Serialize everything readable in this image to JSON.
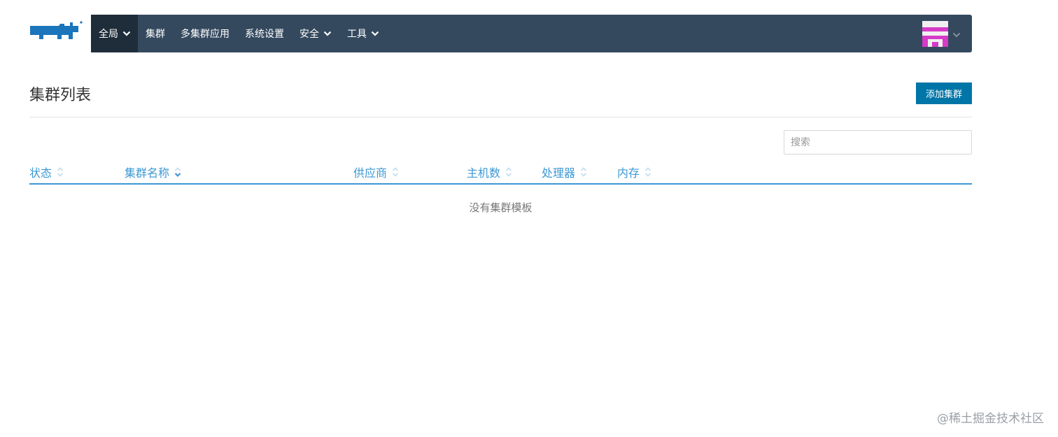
{
  "header": {
    "logo_icon": "rancher-cow-icon",
    "nav": [
      {
        "label": "全局",
        "dropdown": true,
        "active": true
      },
      {
        "label": "集群",
        "dropdown": false,
        "active": false
      },
      {
        "label": "多集群应用",
        "dropdown": false,
        "active": false
      },
      {
        "label": "系统设置",
        "dropdown": false,
        "active": false
      },
      {
        "label": "安全",
        "dropdown": true,
        "active": false
      },
      {
        "label": "工具",
        "dropdown": true,
        "active": false
      }
    ],
    "user_avatar_icon": "identicon-avatar-icon"
  },
  "page": {
    "title": "集群列表",
    "add_button": "添加集群",
    "search_placeholder": "搜索",
    "columns": [
      "状态",
      "集群名称",
      "供应商",
      "主机数",
      "处理器",
      "内存"
    ],
    "sorted_column": "集群名称",
    "empty_message": "没有集群模板"
  },
  "watermark": "@稀土掘金技术社区",
  "colors": {
    "navbar": "#34495e",
    "nav_active": "#1f2d3a",
    "primary": "#0075a8",
    "link": "#3d98d3",
    "logo": "#1b75bb"
  }
}
